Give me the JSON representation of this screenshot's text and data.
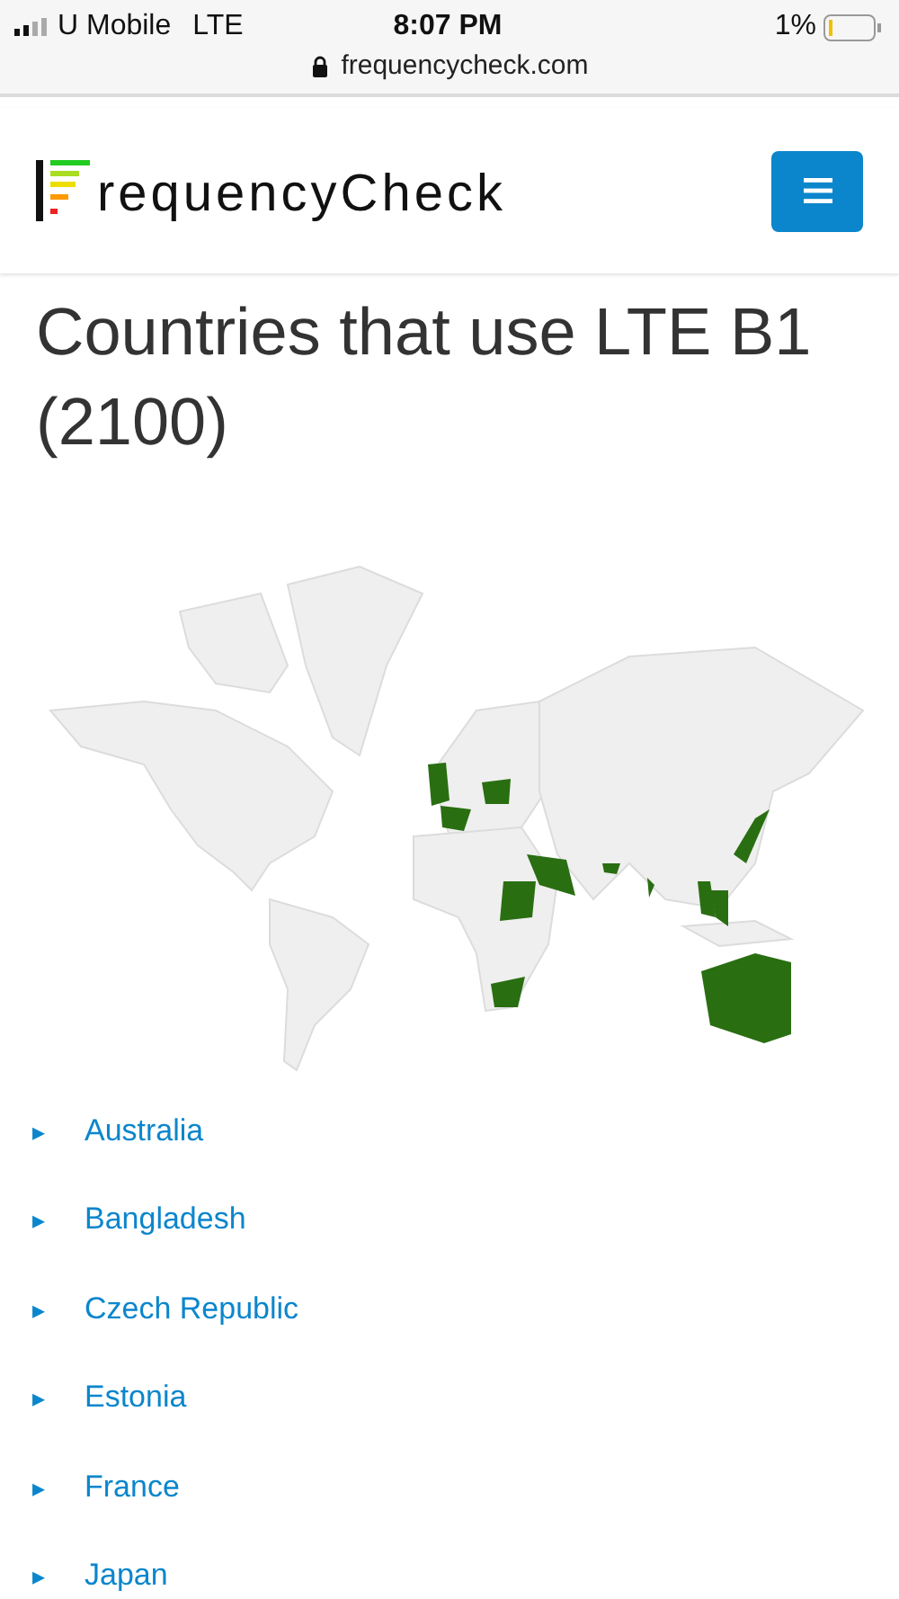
{
  "status_bar": {
    "carrier": "U Mobile",
    "network": "LTE",
    "time": "8:07 PM",
    "battery": "1%"
  },
  "address_bar": {
    "url": "frequencycheck.com"
  },
  "header": {
    "logo_text": "requencyCheck"
  },
  "page": {
    "title": "Countries that use LTE B1 (2100)"
  },
  "countries": [
    {
      "caret": "▸",
      "name": "Australia"
    },
    {
      "caret": "▸",
      "name": "Bangladesh"
    },
    {
      "caret": "▸",
      "name": "Czech Republic"
    },
    {
      "caret": "▸",
      "name": "Estonia"
    },
    {
      "caret": "▸",
      "name": "France"
    },
    {
      "caret": "▸",
      "name": "Japan"
    }
  ]
}
